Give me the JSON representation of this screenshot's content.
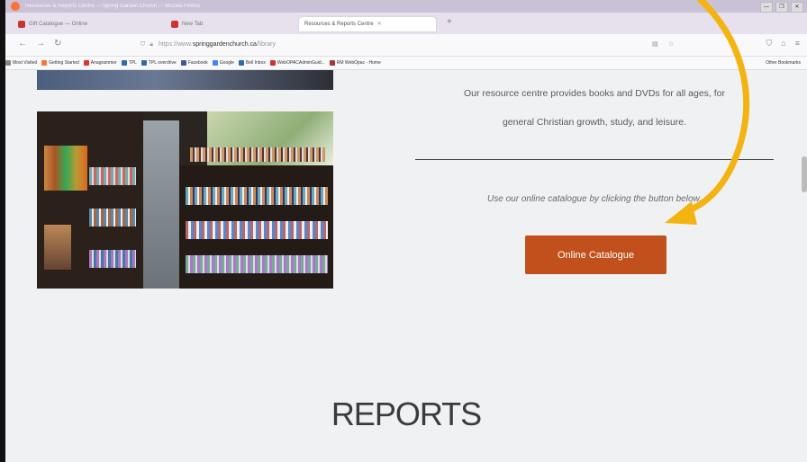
{
  "window": {
    "title": "Resources & Reports Centre — Spring Garden Church — Mozilla Firefox",
    "controls": [
      "—",
      "❐",
      "✕"
    ]
  },
  "tabs": [
    {
      "label": "Gift Catalogue — Online"
    },
    {
      "label": "New Tab"
    },
    {
      "label": "Resources & Reports Centre"
    }
  ],
  "nav": {
    "url_prefix": "https://www.",
    "url_domain": "springgardenchurch.ca",
    "url_path": "/library"
  },
  "bookmarks": [
    {
      "label": "Most Visited",
      "color": "#888888"
    },
    {
      "label": "Getting Started",
      "color": "#ff7139"
    },
    {
      "label": "Anagrammer",
      "color": "#d33"
    },
    {
      "label": "TPL",
      "color": "#2b6cb0"
    },
    {
      "label": "TPL overdrive",
      "color": "#2b6cb0"
    },
    {
      "label": "Facebook",
      "color": "#3b5998"
    },
    {
      "label": "Google",
      "color": "#4285f4"
    },
    {
      "label": "Bell Inbox",
      "color": "#2b6cb0"
    },
    {
      "label": "WebOPACAdminGuid...",
      "color": "#c33"
    },
    {
      "label": "RM WebOpac - Home",
      "color": "#a33"
    }
  ],
  "bookmarks_other": "Other Bookmarks",
  "content": {
    "description_line1": "Our resource centre provides books and DVDs for all ages, for",
    "description_line2": "general Christian growth, study, and leisure.",
    "catalogue_instruction": "Use our online catalogue by clicking the button below.",
    "catalogue_button": "Online Catalogue",
    "reports_heading": "REPORTS"
  },
  "colors": {
    "accent_button": "#c2501c",
    "annotation_arrow": "#f3b411",
    "page_bg": "#f0f1f3"
  }
}
